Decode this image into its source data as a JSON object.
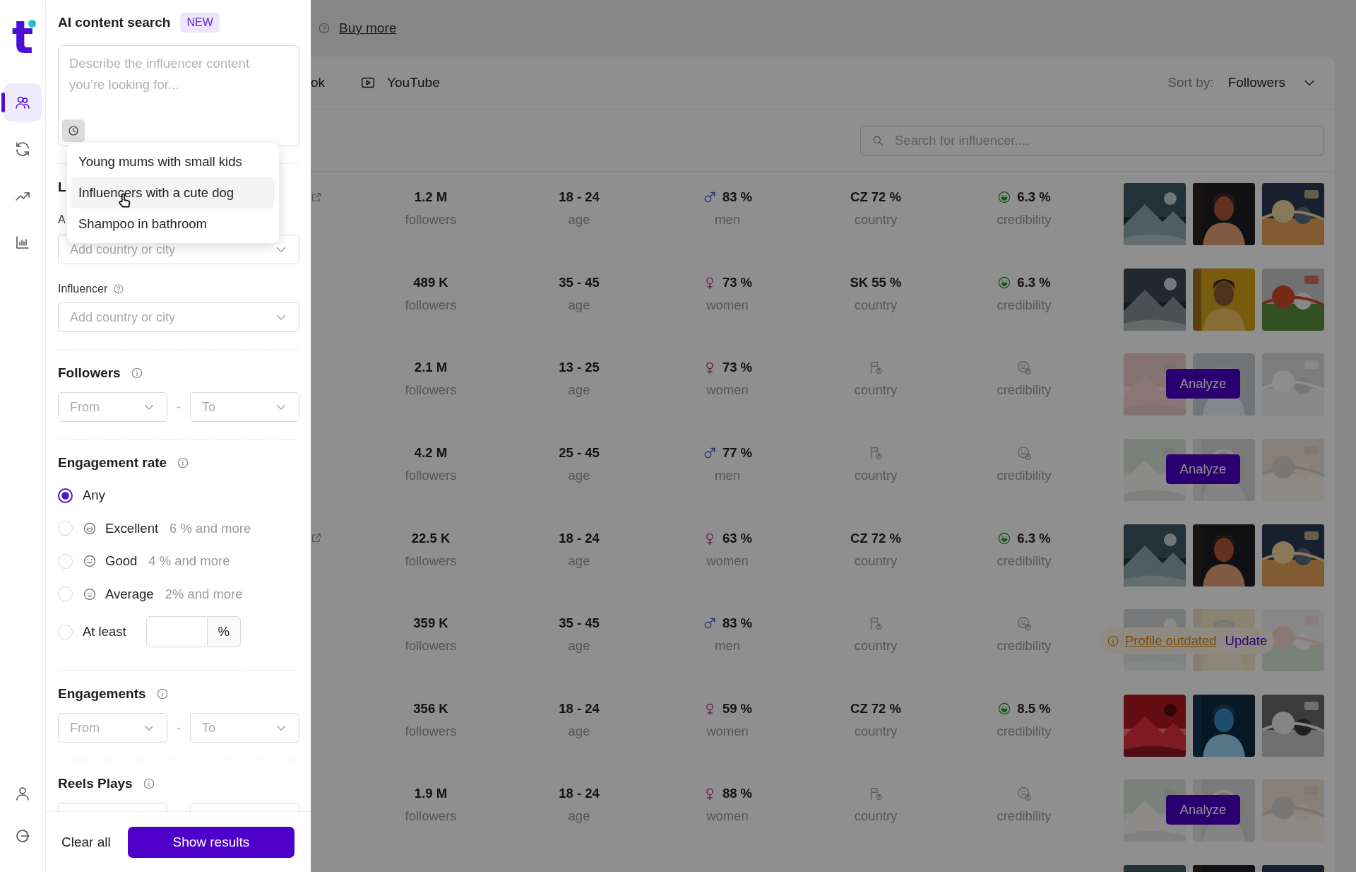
{
  "rail": {
    "logo": "t",
    "items": [
      {
        "kind": "people",
        "selected": true
      },
      {
        "kind": "refresh",
        "selected": false
      },
      {
        "kind": "trend",
        "selected": false
      },
      {
        "kind": "chart",
        "selected": false
      }
    ],
    "bottom": [
      {
        "kind": "user"
      },
      {
        "kind": "logout"
      }
    ]
  },
  "filters": {
    "ai_search": {
      "title": "AI content search",
      "badge": "NEW",
      "placeholder": "Describe the influencer content you’re looking for...",
      "suggestions": [
        {
          "text": "Young mums with small kids",
          "highlighted": false
        },
        {
          "text": "Influencers with a cute dog",
          "highlighted": true
        },
        {
          "text": "Shampoo in bathroom",
          "highlighted": false
        }
      ]
    },
    "location": {
      "heading": "L",
      "label": "A",
      "placeholder": "Add country or city"
    },
    "influencer": {
      "label": "Influencer",
      "placeholder": "Add country or city"
    },
    "followers": {
      "title": "Followers",
      "from": "From",
      "separator": "-",
      "to": "To"
    },
    "engagement_rate": {
      "title": "Engagement rate",
      "options": [
        {
          "kind": "plain",
          "label": "Any",
          "selected": true
        },
        {
          "kind": "excellent",
          "label": "Excellent",
          "hint": "6 % and more",
          "selected": false
        },
        {
          "kind": "good",
          "label": "Good",
          "hint": "4 % and more",
          "selected": false
        },
        {
          "kind": "average",
          "label": "Average",
          "hint": "2% and more",
          "selected": false
        },
        {
          "kind": "custom",
          "label": "At least",
          "unit": "%",
          "selected": false
        }
      ]
    },
    "engagements": {
      "title": "Engagements",
      "from": "From",
      "separator": "-",
      "to": "To"
    },
    "reels_plays": {
      "title": "Reels Plays"
    }
  },
  "footer": {
    "clear": "Clear all",
    "submit": "Show results"
  },
  "main": {
    "buy_more": "Buy more",
    "tabs": [
      {
        "kind": "plain",
        "label": "ok"
      },
      {
        "kind": "youtube",
        "label": "YouTube"
      }
    ],
    "sort_label": "Sort by:",
    "sort_value": "Followers",
    "search_placeholder": "Search for influencer....",
    "rows": [
      {
        "link": true,
        "followers": "1.2 M",
        "followers_label": "followers",
        "age": "18 - 24",
        "age_label": "age",
        "gender": {
          "kind": "male",
          "share": "83 %",
          "label": "men"
        },
        "country": "CZ 72 %",
        "country_label": "country",
        "credibility": "6.3 %",
        "credibility_label": "credibility",
        "media": {
          "kind": "photos"
        }
      },
      {
        "link": false,
        "followers": "489 K",
        "followers_label": "followers",
        "age": "35 - 45",
        "age_label": "age",
        "gender": {
          "kind": "female",
          "share": "73 %",
          "label": "women"
        },
        "country": "SK 55 %",
        "country_label": "country",
        "credibility": "6.3 %",
        "credibility_label": "credibility",
        "media": {
          "kind": "photos"
        }
      },
      {
        "link": false,
        "followers": "2.1 M",
        "followers_label": "followers",
        "age": "13 - 25",
        "age_label": "age",
        "gender": {
          "kind": "female",
          "share": "73 %",
          "label": "women"
        },
        "country_label": "country",
        "credibility_label": "credibility",
        "media": {
          "kind": "analyze",
          "action": "Analyze"
        }
      },
      {
        "link": false,
        "followers": "4.2 M",
        "followers_label": "followers",
        "age": "25 - 45",
        "age_label": "age",
        "gender": {
          "kind": "male",
          "share": "77 %",
          "label": "men"
        },
        "country_label": "country",
        "credibility_label": "credibility",
        "media": {
          "kind": "analyze",
          "action": "Analyze"
        }
      },
      {
        "link": true,
        "followers": "22.5 K",
        "followers_label": "followers",
        "age": "18 - 24",
        "age_label": "age",
        "gender": {
          "kind": "female",
          "share": "63 %",
          "label": "women"
        },
        "country": "CZ 72 %",
        "country_label": "country",
        "credibility": "6.3 %",
        "credibility_label": "credibility",
        "media": {
          "kind": "photos"
        }
      },
      {
        "link": false,
        "followers": "359 K",
        "followers_label": "followers",
        "age": "35 - 45",
        "age_label": "age",
        "gender": {
          "kind": "male",
          "share": "83 %",
          "label": "men"
        },
        "country_label": "country",
        "credibility_label": "credibility",
        "media": {
          "kind": "outdated",
          "warning": "Profile outdated",
          "action": "Update"
        }
      },
      {
        "link": false,
        "followers": "356 K",
        "followers_label": "followers",
        "age": "18 - 24",
        "age_label": "age",
        "gender": {
          "kind": "female",
          "share": "59 %",
          "label": "women"
        },
        "country": "CZ 72 %",
        "country_label": "country",
        "credibility": "8.5 %",
        "credibility_label": "credibility",
        "media": {
          "kind": "photos"
        }
      },
      {
        "link": false,
        "followers": "1.9 M",
        "followers_label": "followers",
        "age": "18 - 24",
        "age_label": "age",
        "gender": {
          "kind": "female",
          "share": "88 %",
          "label": "women"
        },
        "country_label": "country",
        "credibility_label": "credibility",
        "media": {
          "kind": "analyze",
          "action": "Analyze"
        }
      },
      {
        "media": {
          "kind": "photos"
        }
      }
    ]
  }
}
